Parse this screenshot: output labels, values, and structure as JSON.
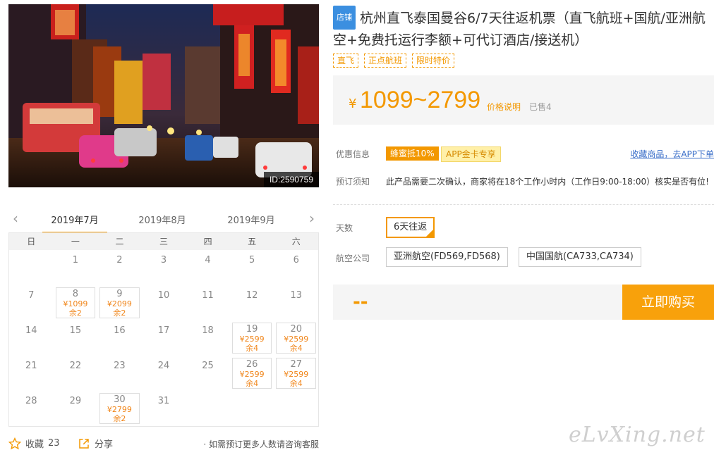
{
  "photo": {
    "id_label": "ID:2590759"
  },
  "calendar": {
    "prev_arrow": "‹",
    "next_arrow": "›",
    "months": [
      "2019年7月",
      "2019年8月",
      "2019年9月"
    ],
    "weekdays": [
      "日",
      "一",
      "二",
      "三",
      "四",
      "五",
      "六"
    ],
    "days": [
      {
        "day": ""
      },
      {
        "day": "1"
      },
      {
        "day": "2"
      },
      {
        "day": "3"
      },
      {
        "day": "4"
      },
      {
        "day": "5"
      },
      {
        "day": "6"
      },
      {
        "day": "7"
      },
      {
        "day": "8",
        "price": "¥1099",
        "stock": "余2"
      },
      {
        "day": "9",
        "price": "¥2099",
        "stock": "余2"
      },
      {
        "day": "10"
      },
      {
        "day": "11"
      },
      {
        "day": "12"
      },
      {
        "day": "13"
      },
      {
        "day": "14"
      },
      {
        "day": "15"
      },
      {
        "day": "16"
      },
      {
        "day": "17"
      },
      {
        "day": "18"
      },
      {
        "day": "19",
        "price": "¥2599",
        "stock": "余4"
      },
      {
        "day": "20",
        "price": "¥2599",
        "stock": "余4"
      },
      {
        "day": "21"
      },
      {
        "day": "22"
      },
      {
        "day": "23"
      },
      {
        "day": "24"
      },
      {
        "day": "25"
      },
      {
        "day": "26",
        "price": "¥2599",
        "stock": "余4"
      },
      {
        "day": "27",
        "price": "¥2599",
        "stock": "余4"
      },
      {
        "day": "28"
      },
      {
        "day": "29"
      },
      {
        "day": "30",
        "price": "¥2799",
        "stock": "余2"
      },
      {
        "day": "31"
      },
      {
        "day": ""
      },
      {
        "day": ""
      },
      {
        "day": ""
      }
    ]
  },
  "bottom": {
    "favorite_label": "收藏",
    "favorite_count": "23",
    "share_label": "分享",
    "note": "· 如需预订更多人数请咨询客服"
  },
  "product": {
    "shop_badge": "店铺",
    "title": "杭州直飞泰国曼谷6/7天往返机票（直飞航班+国航/亚洲航空+免费托运行李额+可代订酒店/接送机）",
    "tags": [
      "直飞",
      "正点航班",
      "限时特价"
    ],
    "price_yen": "¥",
    "price_range": "1099~2799",
    "price_explain": "价格说明",
    "sold": "已售4",
    "promo_label": "优惠信息",
    "promo_tags": [
      "蜂蜜抵10%",
      "APP金卡专享"
    ],
    "collect_link": "收藏商品，去APP下单",
    "notice_label": "预订须知",
    "notice_text": "此产品需要二次确认，商家将在18个工作小时内（工作日9:00-18:00）核实是否有位!",
    "days_label": "天数",
    "days_option": "6天往返",
    "airline_label": "航空公司",
    "airline_options": [
      "亚洲航空(FD569,FD568)",
      "中国国航(CA733,CA734)"
    ],
    "total_placeholder": "--",
    "buy_label": "立即购买"
  },
  "watermark": "eLvXing.net",
  "colors": {
    "accent": "#f39800",
    "link": "#3b6fc9",
    "badge": "#3b8fe0"
  }
}
